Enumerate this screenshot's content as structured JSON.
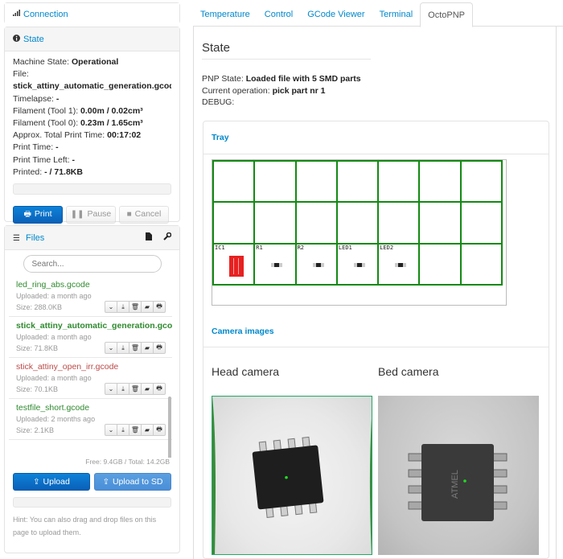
{
  "connection": {
    "title": "Connection"
  },
  "state": {
    "title": "State",
    "machine_state_label": "Machine State:",
    "machine_state": "Operational",
    "file_label": "File:",
    "file": "stick_attiny_automatic_generation.gcode",
    "timelapse_label": "Timelapse:",
    "timelapse": "-",
    "filament1_label": "Filament (Tool 1):",
    "filament1": "0.00m / 0.02cm³",
    "filament0_label": "Filament (Tool 0):",
    "filament0": "0.23m / 1.65cm³",
    "approx_label": "Approx. Total Print Time:",
    "approx": "00:17:02",
    "print_time_label": "Print Time:",
    "print_time": "-",
    "print_time_left_label": "Print Time Left:",
    "print_time_left": "-",
    "printed_label": "Printed:",
    "printed": "- / 71.8KB",
    "progress": 0,
    "buttons": {
      "print": "Print",
      "pause": "Pause",
      "cancel": "Cancel"
    }
  },
  "files": {
    "title": "Files",
    "search_placeholder": "Search...",
    "items": [
      {
        "name": "led_ring_abs.gcode",
        "uploaded": "Uploaded: a month ago",
        "size": "Size: 288.0KB"
      },
      {
        "name": "stick_attiny_automatic_generation.gcode",
        "uploaded": "Uploaded: a month ago",
        "size": "Size: 71.8KB"
      },
      {
        "name": "stick_attiny_open_irr.gcode",
        "uploaded": "Uploaded: a month ago",
        "size": "Size: 70.1KB"
      },
      {
        "name": "testfile_short.gcode",
        "uploaded": "Uploaded: 2 months ago",
        "size": "Size: 2.1KB"
      }
    ],
    "free": "Free: 9.4GB / Total: 14.2GB",
    "upload": "Upload",
    "upload_sd": "Upload to SD",
    "hint": "Hint: You can also drag and drop files on this page to upload them."
  },
  "tabs": [
    "Temperature",
    "Control",
    "GCode Viewer",
    "Terminal",
    "OctoPNP"
  ],
  "octopnp": {
    "heading": "State",
    "pnp_state_label": "PNP State:",
    "pnp_state": "Loaded file with 5 SMD parts",
    "operation_label": "Current operation:",
    "operation": "pick part nr 1",
    "debug_label": "DEBUG:",
    "tray_title": "Tray",
    "tray_labels": [
      "IC1",
      "R1",
      "R2",
      "LED1",
      "LED2"
    ],
    "camera_title": "Camera images",
    "head_camera": "Head camera",
    "bed_camera": "Bed camera",
    "chip_text": "ATMEL"
  }
}
